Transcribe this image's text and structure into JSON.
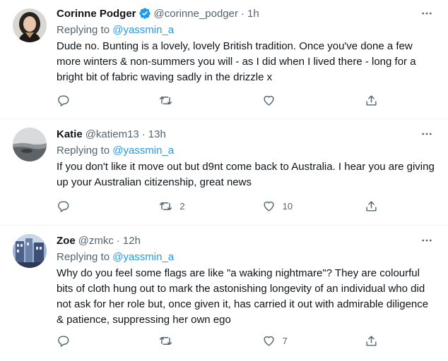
{
  "tweets": [
    {
      "name": "Corinne Podger",
      "verified": true,
      "handle": "@corinne_podger",
      "separator": "·",
      "time": "1h",
      "replying_prefix": "Replying to",
      "replying_to": "@yassmin_a",
      "text": "Dude no. Bunting is a lovely, lovely British tradition. Once you've done a few more winters & non-summers you will - as I did when I lived there - long for a bright bit of fabric waving sadly in the drizzle x",
      "counts": {
        "reply": "",
        "retweet": "",
        "like": ""
      }
    },
    {
      "name": "Katie",
      "verified": false,
      "handle": "@katiem13",
      "separator": "·",
      "time": "13h",
      "replying_prefix": "Replying to",
      "replying_to": "@yassmin_a",
      "text": "If you don't like it move out but d9nt come back to Australia. I hear you are giving up your Australian citizenship, great news",
      "counts": {
        "reply": "",
        "retweet": "2",
        "like": "10"
      }
    },
    {
      "name": "Zoe",
      "verified": false,
      "handle": "@zmkc",
      "separator": "·",
      "time": "12h",
      "replying_prefix": "Replying to",
      "replying_to": "@yassmin_a",
      "text": "Why do you feel some flags are like \"a waking nightmare\"? They are colourful bits of cloth hung out to mark the astonishing longevity of an individual who did not ask for her role but, once given it, has carried it out with admirable diligence & patience, suppressing her own ego",
      "counts": {
        "reply": "",
        "retweet": "",
        "like": "7"
      }
    }
  ],
  "icons": {
    "verified": "verified-badge-icon",
    "more": "more-options-icon",
    "reply": "reply-icon",
    "retweet": "retweet-icon",
    "like": "like-icon",
    "share": "share-icon"
  },
  "colors": {
    "accent": "#1d9bf0",
    "secondary_text": "#536471",
    "divider": "#eff3f4"
  }
}
